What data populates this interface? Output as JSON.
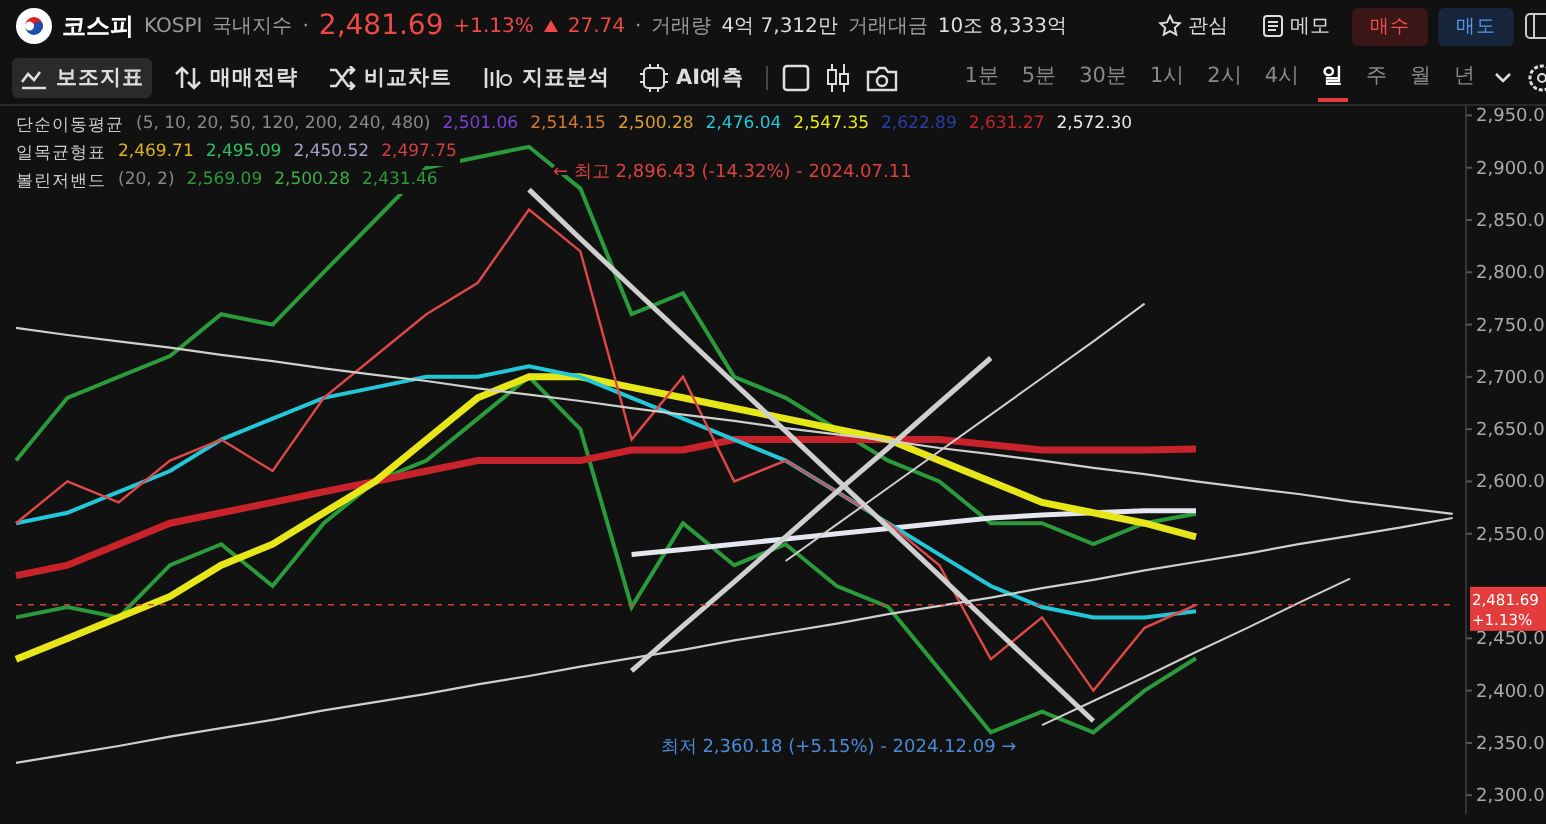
{
  "header": {
    "name": "코스피",
    "code": "KOSPI",
    "market": "국내지수",
    "separator": "·",
    "price": "2,481.69",
    "change_pct": "+1.13%",
    "rising": true,
    "change": "27.74",
    "separator_2": "·",
    "volume_label": "거래량",
    "volume": "4억 7,312만",
    "amount_label": "거래대금",
    "amount": "10조 8,333억",
    "actions": [
      {
        "kind": "watch",
        "label": "관심"
      },
      {
        "kind": "memo",
        "label": "메모"
      },
      {
        "kind": "buy",
        "label": "매수"
      },
      {
        "kind": "sell",
        "label": "매도"
      }
    ]
  },
  "toolbar": {
    "tools": [
      {
        "kind": "indicator",
        "label": "보조지표",
        "selected": true
      },
      {
        "kind": "strategy",
        "label": "매매전략",
        "selected": false
      },
      {
        "kind": "compare",
        "label": "비교차트",
        "selected": false
      },
      {
        "kind": "analysis",
        "label": "지표분석",
        "selected": false
      },
      {
        "kind": "ai",
        "label": "AI예측",
        "selected": false
      }
    ],
    "timeframes": [
      {
        "label": "1분",
        "selected": false
      },
      {
        "label": "5분",
        "selected": false
      },
      {
        "label": "30분",
        "selected": false
      },
      {
        "label": "1시",
        "selected": false
      },
      {
        "label": "2시",
        "selected": false
      },
      {
        "label": "4시",
        "selected": false
      },
      {
        "label": "일",
        "selected": true
      },
      {
        "label": "주",
        "selected": false
      },
      {
        "label": "월",
        "selected": false
      },
      {
        "label": "년",
        "selected": false
      }
    ]
  },
  "legends": [
    {
      "label": "단순이동평균",
      "params": "(5, 10, 20, 50, 120, 200, 240, 480)",
      "values": [
        {
          "text": "2,501.06",
          "color": "#7b3fd6"
        },
        {
          "text": "2,514.15",
          "color": "#d2772e"
        },
        {
          "text": "2,500.28",
          "color": "#d9a12c"
        },
        {
          "text": "2,476.04",
          "color": "#22c8d8"
        },
        {
          "text": "2,547.35",
          "color": "#e6e619"
        },
        {
          "text": "2,622.89",
          "color": "#2a3ea8"
        },
        {
          "text": "2,631.27",
          "color": "#c8232a"
        },
        {
          "text": "2,572.30",
          "color": "#e6e6f0"
        }
      ]
    },
    {
      "label": "일목균형표",
      "values": [
        {
          "text": "2,469.71",
          "color": "#e0b020"
        },
        {
          "text": "2,495.09",
          "color": "#2ec060"
        },
        {
          "text": "2,450.52",
          "color": "#a0a0c8"
        },
        {
          "text": "2,497.75",
          "color": "#d04040"
        }
      ]
    },
    {
      "label": "볼린저밴드",
      "params": "(20, 2)",
      "values": [
        {
          "text": "2,569.09",
          "color": "#2a9a3a"
        },
        {
          "text": "2,500.28",
          "color": "#3fae3f"
        },
        {
          "text": "2,431.46",
          "color": "#2a9a3a"
        }
      ]
    }
  ],
  "chart": {
    "last_price": "2,481.69",
    "last_change": "+1.13%",
    "chart_data": {
      "type": "line",
      "ylim": [
        2282,
        2959
      ],
      "yticks": [
        {
          "value": 2300,
          "label": "2,300.0"
        },
        {
          "value": 2350,
          "label": "2,350.0"
        },
        {
          "value": 2400,
          "label": "2,400.0"
        },
        {
          "value": 2450,
          "label": "2,450.0"
        },
        {
          "value": 2550,
          "label": "2,550.0"
        },
        {
          "value": 2600,
          "label": "2,600.0"
        },
        {
          "value": 2650,
          "label": "2,650.0"
        },
        {
          "value": 2700,
          "label": "2,700.0"
        },
        {
          "value": 2750,
          "label": "2,750.0"
        },
        {
          "value": 2800,
          "label": "2,800.0"
        },
        {
          "value": 2850,
          "label": "2,850.0"
        },
        {
          "value": 2900,
          "label": "2,900.0"
        },
        {
          "value": 2950,
          "label": "2,950.0"
        }
      ],
      "series": [
        {
          "color": "#2a9a3a",
          "values": [
            2620,
            2680,
            2700,
            2720,
            2760,
            2750,
            2800,
            2850,
            2900,
            2910,
            2920,
            2880,
            2760,
            2780,
            2700,
            2680,
            2650,
            2620,
            2600,
            2560,
            2560,
            2540,
            2560,
            2569
          ]
        },
        {
          "color": "#2a9a3a",
          "values": [
            2470,
            2480,
            2470,
            2520,
            2540,
            2500,
            2560,
            2600,
            2620,
            2660,
            2700,
            2650,
            2480,
            2560,
            2520,
            2540,
            2500,
            2480,
            2420,
            2360,
            2380,
            2360,
            2400,
            2431
          ]
        },
        {
          "color": "#c8232a",
          "values": [
            2510,
            2520,
            2540,
            2560,
            2570,
            2580,
            2590,
            2600,
            2610,
            2620,
            2620,
            2620,
            2630,
            2630,
            2640,
            2640,
            2640,
            2640,
            2640,
            2635,
            2630,
            2630,
            2630,
            2631
          ]
        },
        {
          "color": "#e6e6f0",
          "values": [
            null,
            null,
            null,
            null,
            null,
            null,
            null,
            null,
            null,
            null,
            null,
            null,
            2530,
            2535,
            2540,
            2545,
            2550,
            2555,
            2560,
            2565,
            2568,
            2570,
            2572,
            2572
          ]
        },
        {
          "color": "#e6e619",
          "values": [
            2430,
            2450,
            2470,
            2490,
            2520,
            2540,
            2570,
            2600,
            2640,
            2680,
            2700,
            2700,
            2690,
            2680,
            2670,
            2660,
            2650,
            2640,
            2620,
            2600,
            2580,
            2570,
            2560,
            2547
          ]
        },
        {
          "color": "#22c8d8",
          "values": [
            2560,
            2570,
            2590,
            2610,
            2640,
            2660,
            2680,
            2690,
            2700,
            2700,
            2710,
            2700,
            2680,
            2660,
            2640,
            2620,
            2590,
            2560,
            2530,
            2500,
            2480,
            2470,
            2470,
            2476
          ]
        },
        {
          "color": "#e04848",
          "values": [
            2560,
            2600,
            2580,
            2620,
            2640,
            2610,
            2680,
            2720,
            2760,
            2790,
            2860,
            2820,
            2640,
            2700,
            2600,
            2620,
            2590,
            2560,
            2520,
            2430,
            2470,
            2400,
            2460,
            2482
          ]
        },
        {
          "color": "#cfcfcf",
          "values": [
            2747,
            2740,
            2734,
            2728,
            2721,
            2715,
            2708,
            2702,
            2696,
            2689,
            2683,
            2677,
            2670,
            2664,
            2658,
            2651,
            2645,
            2639,
            2632,
            2626,
            2620,
            2613,
            2607,
            2600,
            2594,
            2588,
            2581,
            2575,
            2569
          ]
        },
        {
          "color": "#cfcfcf",
          "values": [
            2331,
            2339,
            2347,
            2356,
            2364,
            2372,
            2381,
            2389,
            2397,
            2406,
            2414,
            2423,
            2431,
            2439,
            2448,
            2456,
            2464,
            2473,
            2481,
            2489,
            2498,
            2506,
            2515,
            2523,
            2531,
            2540,
            2548,
            2556,
            2565
          ]
        },
        {
          "color": "#cfcfcf",
          "values": [
            null,
            null,
            null,
            null,
            null,
            null,
            null,
            null,
            null,
            null,
            2879,
            2832,
            2786,
            2740,
            2694,
            2648,
            2602,
            2556,
            2510,
            2463,
            2417,
            2371
          ]
        },
        {
          "color": "#cfcfcf",
          "values": [
            null,
            null,
            null,
            null,
            null,
            null,
            null,
            null,
            null,
            null,
            null,
            null,
            2419,
            2462,
            2504,
            2547,
            2590,
            2632,
            2675,
            2718
          ]
        },
        {
          "color": "#cfcfcf",
          "values": [
            null,
            null,
            null,
            null,
            null,
            null,
            null,
            null,
            null,
            null,
            null,
            null,
            null,
            null,
            null,
            2524,
            2559,
            2594,
            2629,
            2664,
            2699,
            2734,
            2770
          ]
        },
        {
          "color": "#cfcfcf",
          "values": [
            null,
            null,
            null,
            null,
            null,
            null,
            null,
            null,
            null,
            null,
            null,
            null,
            null,
            null,
            null,
            null,
            null,
            null,
            null,
            null,
            2367,
            2390,
            2413,
            2437,
            2460,
            2484,
            2507
          ]
        },
        {
          "color": "#c84040",
          "line_style": "dashed",
          "values": [
            2482,
            2482,
            2482,
            2482,
            2482,
            2482,
            2482,
            2482,
            2482,
            2482,
            2482,
            2482,
            2482,
            2482,
            2482,
            2482,
            2482,
            2482,
            2482,
            2482,
            2482,
            2482,
            2482,
            2482,
            2482,
            2482,
            2482,
            2482,
            2482
          ]
        }
      ],
      "annotations": [
        "← 최고 2,896.43 (-14.32%) - 2024.07.11",
        "최저 2,360.18 (+5.15%) - 2024.12.09 →"
      ]
    }
  }
}
